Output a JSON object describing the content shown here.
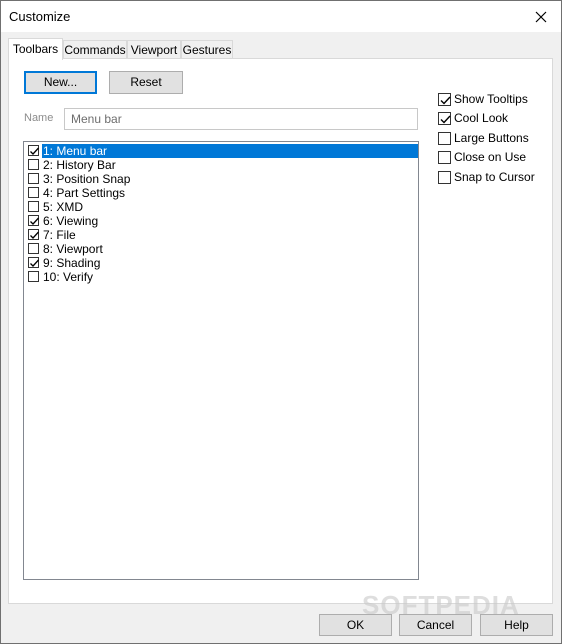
{
  "window": {
    "title": "Customize"
  },
  "tabs": [
    {
      "label": "Toolbars",
      "active": true
    },
    {
      "label": "Commands",
      "active": false
    },
    {
      "label": "Viewport",
      "active": false
    },
    {
      "label": "Gestures",
      "active": false
    }
  ],
  "toolbar_buttons": {
    "new": "New...",
    "reset": "Reset"
  },
  "name_field": {
    "label": "Name",
    "placeholder": "Menu bar"
  },
  "toolbar_list": [
    {
      "label": "1: Menu bar",
      "checked": true,
      "selected": true
    },
    {
      "label": "2: History Bar",
      "checked": false,
      "selected": false
    },
    {
      "label": "3: Position Snap",
      "checked": false,
      "selected": false
    },
    {
      "label": "4: Part Settings",
      "checked": false,
      "selected": false
    },
    {
      "label": "5: XMD",
      "checked": false,
      "selected": false
    },
    {
      "label": "6: Viewing",
      "checked": true,
      "selected": false
    },
    {
      "label": "7: File",
      "checked": true,
      "selected": false
    },
    {
      "label": "8: Viewport",
      "checked": false,
      "selected": false
    },
    {
      "label": "9: Shading",
      "checked": true,
      "selected": false
    },
    {
      "label": "10: Verify",
      "checked": false,
      "selected": false
    }
  ],
  "options": [
    {
      "label": "Show Tooltips",
      "checked": true
    },
    {
      "label": "Cool Look",
      "checked": true
    },
    {
      "label": "Large Buttons",
      "checked": false
    },
    {
      "label": "Close on Use",
      "checked": false
    },
    {
      "label": "Snap to Cursor",
      "checked": false
    }
  ],
  "footer": {
    "ok": "OK",
    "cancel": "Cancel",
    "help": "Help"
  },
  "watermark": "SOFTPEDIA",
  "colors": {
    "selection": "#0078d7",
    "default_button_border": "#0078d7"
  }
}
